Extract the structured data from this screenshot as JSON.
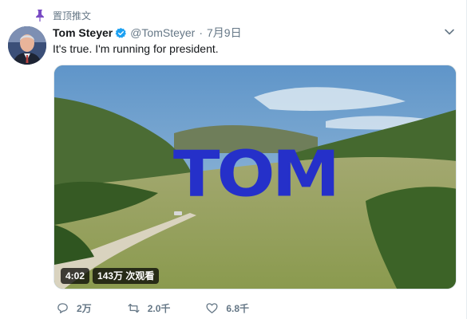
{
  "pinned": {
    "label": "置顶推文",
    "icon": "pin-icon"
  },
  "author": {
    "name": "Tom Steyer",
    "verified_icon": "verified-badge-icon",
    "handle": "@TomSteyer",
    "separator": "·",
    "timestamp": "7月9日",
    "avatar": "author-avatar"
  },
  "tweet": {
    "text": "It's true. I'm running for president."
  },
  "media": {
    "title_text": "TOM",
    "duration": "4:02",
    "views": "143万 次观看"
  },
  "actions": {
    "reply_count": "2万",
    "retweet_count": "2.0千",
    "like_count": "6.8千"
  },
  "colors": {
    "title_blue": "#2530c9",
    "meta_gray": "#657786",
    "verified_blue": "#1da1f2",
    "pin_purple": "#794bc4"
  }
}
